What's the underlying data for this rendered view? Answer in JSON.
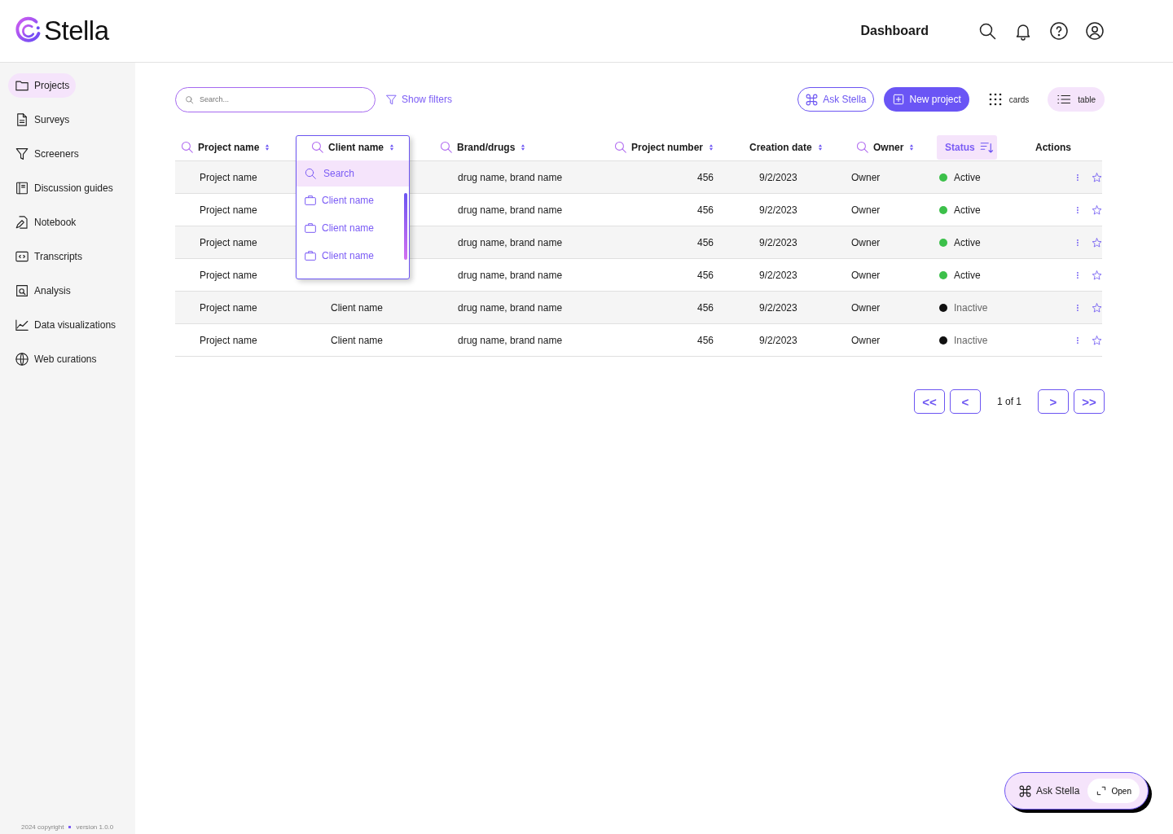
{
  "header": {
    "logo": "Stella",
    "title": "Dashboard"
  },
  "sidebar": {
    "items": [
      {
        "label": "Projects",
        "selected": true
      },
      {
        "label": "Surveys",
        "selected": false
      },
      {
        "label": "Screeners",
        "selected": false
      },
      {
        "label": "Discussion guides",
        "selected": false
      },
      {
        "label": "Notebook",
        "selected": false
      },
      {
        "label": "Transcripts",
        "selected": false
      },
      {
        "label": "Analysis",
        "selected": false
      },
      {
        "label": "Data visualizations",
        "selected": false
      },
      {
        "label": "Web curations",
        "selected": false
      }
    ],
    "footer": {
      "copyright": "2024 copyright",
      "version": "version 1.0.0"
    }
  },
  "toolbar": {
    "search": {
      "placeholder": "Search..."
    },
    "filters": "Show filters",
    "ask": "Ask Stella",
    "new_project": "New project",
    "views": [
      {
        "label": "cards",
        "selected": false
      },
      {
        "label": "table",
        "selected": true
      }
    ]
  },
  "table": {
    "columns": [
      {
        "label": "Project name",
        "searchable": true,
        "sortable": true,
        "sorted": false
      },
      {
        "label": "Client name",
        "searchable": true,
        "sortable": true,
        "sorted": false
      },
      {
        "label": "Brand/drugs",
        "searchable": true,
        "sortable": true,
        "sorted": false
      },
      {
        "label": "Project number",
        "searchable": true,
        "sortable": true,
        "sorted": false
      },
      {
        "label": "Creation date",
        "searchable": false,
        "sortable": true,
        "sorted": false
      },
      {
        "label": "Owner",
        "searchable": true,
        "sortable": true,
        "sorted": false
      },
      {
        "label": "Status",
        "searchable": false,
        "sortable": false,
        "sorted": true
      },
      {
        "label": "Actions",
        "searchable": false,
        "sortable": false,
        "sorted": false
      }
    ],
    "rows": [
      {
        "project": "Project name",
        "brand": "drug name, brand name",
        "number": "456",
        "date": "9/2/2023",
        "owner": "Owner",
        "status": {
          "kind": "active",
          "label": "Active",
          "color": "#3cc04a"
        }
      },
      {
        "project": "Project name",
        "brand": "drug name, brand name",
        "number": "456",
        "date": "9/2/2023",
        "owner": "Owner",
        "status": {
          "kind": "active",
          "label": "Active",
          "color": "#3cc04a"
        }
      },
      {
        "project": "Project name",
        "brand": "drug name, brand name",
        "number": "456",
        "date": "9/2/2023",
        "owner": "Owner",
        "status": {
          "kind": "active",
          "label": "Active",
          "color": "#3cc04a"
        }
      },
      {
        "project": "Project name",
        "brand": "drug name, brand name",
        "number": "456",
        "date": "9/2/2023",
        "owner": "Owner",
        "status": {
          "kind": "active",
          "label": "Active",
          "color": "#3cc04a"
        }
      },
      {
        "project": "Project name",
        "client": "Client name",
        "brand": "drug name, brand name",
        "number": "456",
        "date": "9/2/2023",
        "owner": "Owner",
        "status": {
          "kind": "inactive",
          "label": "Inactive",
          "color": "#111111"
        }
      },
      {
        "project": "Project name",
        "client": "Client name",
        "brand": "drug name, brand name",
        "number": "456",
        "date": "9/2/2023",
        "owner": "Owner",
        "status": {
          "kind": "inactive",
          "label": "Inactive",
          "color": "#111111"
        }
      }
    ],
    "dropdown": {
      "items": [
        {
          "kind": "search",
          "label": "Search"
        },
        {
          "kind": "option",
          "label": "Client name"
        },
        {
          "kind": "option",
          "label": "Client name"
        },
        {
          "kind": "option",
          "label": "Client name"
        }
      ]
    }
  },
  "pagination": {
    "first": "<<",
    "prev": "<",
    "page": "1 of 1",
    "next": ">",
    "last": ">>"
  },
  "assistant": {
    "label": "Ask Stella",
    "open": "Open"
  }
}
